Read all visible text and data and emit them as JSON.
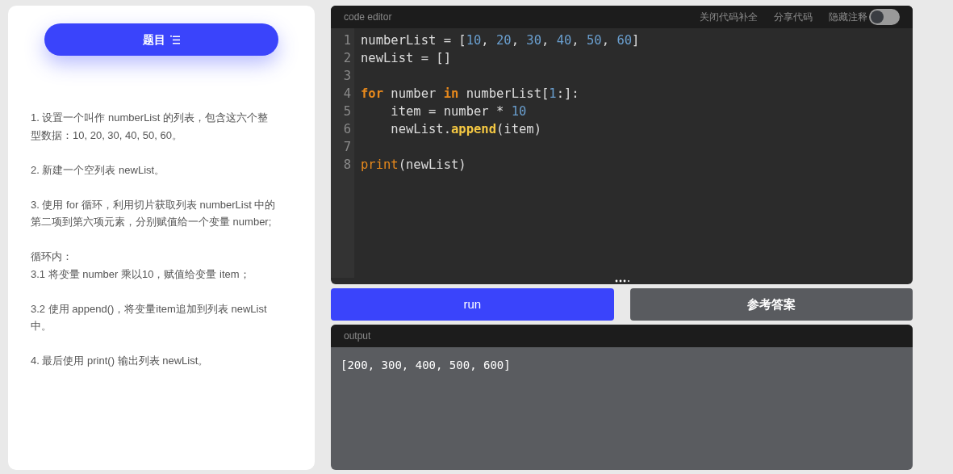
{
  "task_button": {
    "label": "题目"
  },
  "instructions": [
    {
      "lines": [
        "1. 设置一个叫作 numberList 的列表，包含这六个整型数据：10, 20, 30, 40, 50, 60。"
      ]
    },
    {
      "lines": [
        "2. 新建一个空列表 newList。"
      ]
    },
    {
      "lines": [
        "3. 使用 for 循环，利用切片获取列表 numberList 中的第二项到第六项元素，分别赋值给一个变量 number;"
      ]
    },
    {
      "lines": [
        "循环内：",
        "3.1 将变量 number 乘以10，赋值给变量 item；"
      ]
    },
    {
      "lines": [
        "3.2 使用 append()，将变量item追加到列表 newList 中。"
      ]
    },
    {
      "lines": [
        "4. 最后使用 print() 输出列表 newList。"
      ]
    }
  ],
  "editor": {
    "title": "code editor",
    "actions": [
      "关闭代码补全",
      "分享代码"
    ],
    "toggle": {
      "label": "隐藏注释",
      "on": false
    },
    "lines": [
      {
        "number": "1",
        "tokens": [
          {
            "kind": "plain",
            "text": "numberList = ["
          },
          {
            "kind": "number",
            "text": "10"
          },
          {
            "kind": "plain",
            "text": ", "
          },
          {
            "kind": "number",
            "text": "20"
          },
          {
            "kind": "plain",
            "text": ", "
          },
          {
            "kind": "number",
            "text": "30"
          },
          {
            "kind": "plain",
            "text": ", "
          },
          {
            "kind": "number",
            "text": "40"
          },
          {
            "kind": "plain",
            "text": ", "
          },
          {
            "kind": "number",
            "text": "50"
          },
          {
            "kind": "plain",
            "text": ", "
          },
          {
            "kind": "number",
            "text": "60"
          },
          {
            "kind": "plain",
            "text": "]"
          }
        ]
      },
      {
        "number": "2",
        "tokens": [
          {
            "kind": "plain",
            "text": "newList = []"
          }
        ]
      },
      {
        "number": "3"
      },
      {
        "number": "4",
        "tokens": [
          {
            "kind": "keyword",
            "text": "for"
          },
          {
            "kind": "plain",
            "text": " number "
          },
          {
            "kind": "keyword",
            "text": "in"
          },
          {
            "kind": "plain",
            "text": " numberList["
          },
          {
            "kind": "number",
            "text": "1"
          },
          {
            "kind": "plain",
            "text": ":]:"
          }
        ]
      },
      {
        "number": "5",
        "tokens": [
          {
            "kind": "plain",
            "text": "    item = number * "
          },
          {
            "kind": "number",
            "text": "10"
          }
        ]
      },
      {
        "number": "6",
        "tokens": [
          {
            "kind": "plain",
            "text": "    newList."
          },
          {
            "kind": "method",
            "text": "append"
          },
          {
            "kind": "plain",
            "text": "(item)"
          }
        ]
      },
      {
        "number": "7"
      },
      {
        "number": "8",
        "tokens": [
          {
            "kind": "builtin",
            "text": "print"
          },
          {
            "kind": "plain",
            "text": "(newList)"
          }
        ]
      }
    ]
  },
  "buttons": [
    {
      "label": "run",
      "kind": "primary"
    },
    {
      "label": "参考答案",
      "kind": "secondary"
    }
  ],
  "output": {
    "title": "output",
    "text": "[200, 300, 400, 500, 600]"
  }
}
